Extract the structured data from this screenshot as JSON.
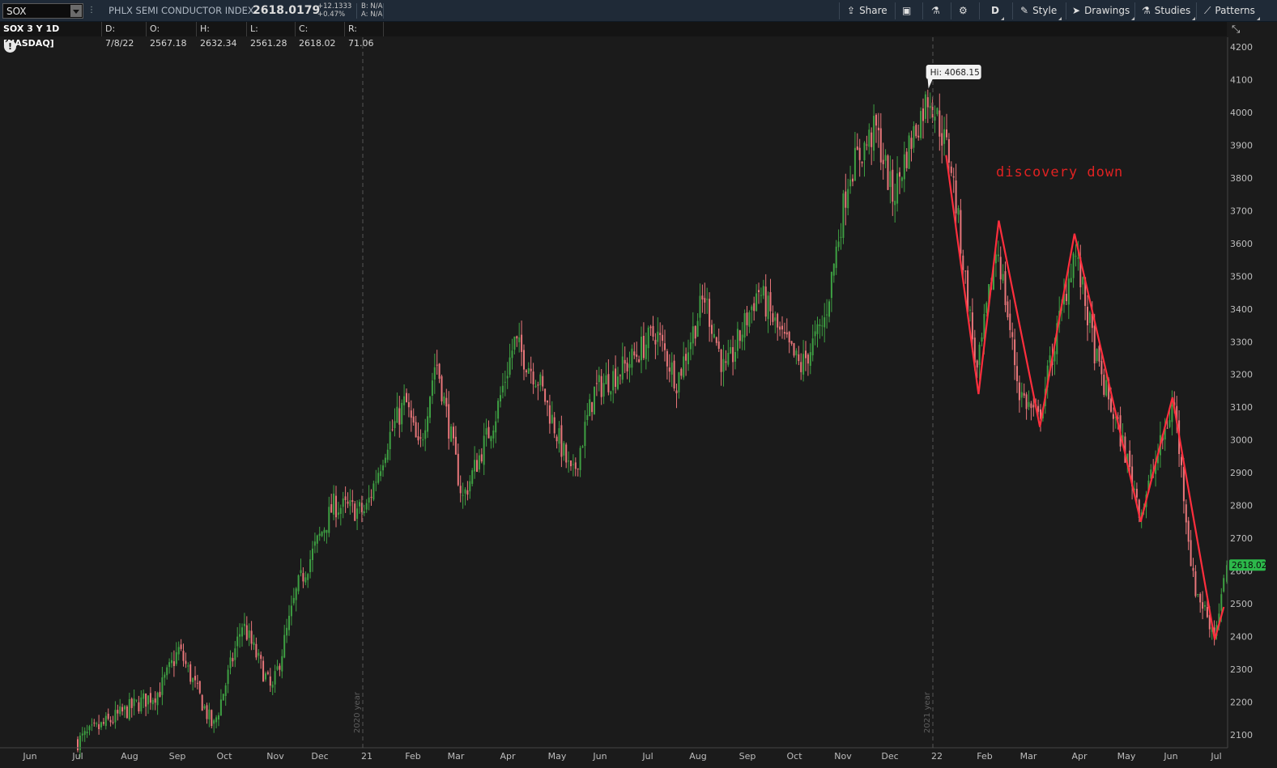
{
  "toolbar": {
    "symbol": "SOX",
    "description": "PHLX SEMI CONDUCTOR INDEX",
    "last_price": "2618.0179",
    "change": "+12.1333",
    "change_pct": "+0.47%",
    "bid": "B: N/A",
    "ask": "A: N/A",
    "share_label": "Share",
    "aggregation_label": "D",
    "style_label": "Style",
    "drawings_label": "Drawings",
    "studies_label": "Studies",
    "patterns_label": "Patterns"
  },
  "info_bar": {
    "title": "SOX 3 Y 1D [NASDAQ]",
    "date": "D: 7/8/22",
    "open": "O: 2567.18",
    "high": "H: 2632.34",
    "low": "L: 2561.28",
    "close": "C: 2618.02",
    "range": "R: 71.06"
  },
  "colors": {
    "up": "#3ea043",
    "down": "#e8767a",
    "zigzag": "#ff2e3d",
    "annotation": "#e02222",
    "price_badge": "#2cb84a"
  },
  "chart_data": {
    "type": "candlestick",
    "x_ticks": [
      "Jun",
      "Jul",
      "Aug",
      "Sep",
      "Oct",
      "Nov",
      "Dec",
      "21",
      "Feb",
      "Mar",
      "Apr",
      "May",
      "Jun",
      "Jul",
      "Aug",
      "Sep",
      "Oct",
      "Nov",
      "Dec",
      "22",
      "Feb",
      "Mar",
      "Apr",
      "May",
      "Jun",
      "Jul"
    ],
    "year_markers": [
      {
        "before_tick": "21",
        "label": "2020 year"
      },
      {
        "before_tick": "22",
        "label": "2021 year"
      }
    ],
    "y_ticks": [
      2100,
      2200,
      2300,
      2400,
      2500,
      2600,
      2700,
      2800,
      2900,
      3000,
      3100,
      3200,
      3300,
      3400,
      3500,
      3600,
      3700,
      3800,
      3900,
      4000,
      4100,
      4200
    ],
    "ylim": [
      2060,
      4230
    ],
    "price_path": [
      {
        "date": "2020-07-01",
        "close": 2080
      },
      {
        "date": "2020-08-01",
        "close": 2180
      },
      {
        "date": "2020-08-20",
        "close": 2230
      },
      {
        "date": "2020-09-02",
        "close": 2360
      },
      {
        "date": "2020-09-24",
        "close": 2120
      },
      {
        "date": "2020-10-12",
        "close": 2440
      },
      {
        "date": "2020-10-30",
        "close": 2230
      },
      {
        "date": "2020-11-16",
        "close": 2550
      },
      {
        "date": "2020-12-10",
        "close": 2800
      },
      {
        "date": "2020-12-31",
        "close": 2780
      },
      {
        "date": "2021-01-15",
        "close": 3000
      },
      {
        "date": "2021-01-27",
        "close": 3120
      },
      {
        "date": "2021-02-05",
        "close": 2960
      },
      {
        "date": "2021-02-16",
        "close": 3250
      },
      {
        "date": "2021-03-05",
        "close": 2820
      },
      {
        "date": "2021-03-25",
        "close": 3080
      },
      {
        "date": "2021-04-05",
        "close": 3300
      },
      {
        "date": "2021-04-20",
        "close": 3180
      },
      {
        "date": "2021-05-12",
        "close": 2880
      },
      {
        "date": "2021-05-28",
        "close": 3150
      },
      {
        "date": "2021-06-18",
        "close": 3230
      },
      {
        "date": "2021-07-06",
        "close": 3330
      },
      {
        "date": "2021-07-19",
        "close": 3180
      },
      {
        "date": "2021-08-05",
        "close": 3440
      },
      {
        "date": "2021-08-18",
        "close": 3200
      },
      {
        "date": "2021-09-08",
        "close": 3460
      },
      {
        "date": "2021-09-22",
        "close": 3320
      },
      {
        "date": "2021-10-05",
        "close": 3220
      },
      {
        "date": "2021-10-20",
        "close": 3360
      },
      {
        "date": "2021-11-05",
        "close": 3820
      },
      {
        "date": "2021-11-22",
        "close": 3950
      },
      {
        "date": "2021-12-03",
        "close": 3740
      },
      {
        "date": "2021-12-13",
        "close": 3890
      },
      {
        "date": "2021-12-27",
        "close": 4060
      },
      {
        "date": "2022-01-10",
        "close": 3850
      },
      {
        "date": "2022-01-27",
        "close": 3200
      },
      {
        "date": "2022-02-09",
        "close": 3600
      },
      {
        "date": "2022-02-23",
        "close": 3150
      },
      {
        "date": "2022-03-07",
        "close": 3060
      },
      {
        "date": "2022-03-29",
        "close": 3580
      },
      {
        "date": "2022-04-13",
        "close": 3220
      },
      {
        "date": "2022-04-28",
        "close": 3000
      },
      {
        "date": "2022-05-11",
        "close": 2780
      },
      {
        "date": "2022-05-26",
        "close": 3000
      },
      {
        "date": "2022-06-03",
        "close": 3120
      },
      {
        "date": "2022-06-16",
        "close": 2560
      },
      {
        "date": "2022-06-30",
        "close": 2410
      },
      {
        "date": "2022-07-08",
        "close": 2618
      }
    ],
    "last_close": 2618.02,
    "last_close_label": "2618.02",
    "high_label": "Hi: 4068.15",
    "high_value": 4068.15,
    "high_date": "2021-12-27",
    "annotation_text": "discovery down",
    "zigzag": [
      {
        "date": "2022-01-07",
        "value": 3870
      },
      {
        "date": "2022-01-28",
        "value": 3140
      },
      {
        "date": "2022-02-10",
        "value": 3670
      },
      {
        "date": "2022-03-08",
        "value": 3040
      },
      {
        "date": "2022-03-29",
        "value": 3630
      },
      {
        "date": "2022-05-11",
        "value": 2750
      },
      {
        "date": "2022-06-02",
        "value": 3130
      },
      {
        "date": "2022-06-30",
        "value": 2390
      },
      {
        "date": "2022-07-06",
        "value": 2490
      }
    ],
    "grid": false
  }
}
